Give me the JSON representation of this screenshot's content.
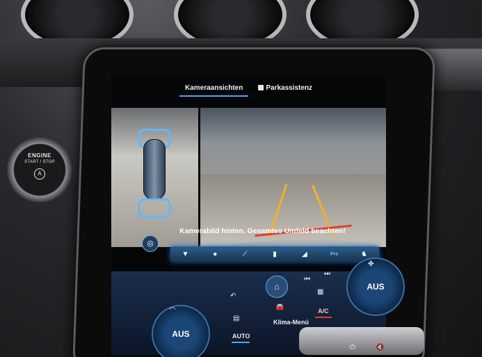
{
  "tabs": [
    {
      "label": "Kameraansichten",
      "active": true
    },
    {
      "label": "Parkassistenz",
      "active": false
    }
  ],
  "camera": {
    "message": "Kamerabild hinten. Gesamtes Umfeld beachten!"
  },
  "view_icons": [
    "view-rear-icon",
    "view-person-icon",
    "view-side-icon",
    "view-car-side-icon",
    "view-car-icon",
    "view-pre-icon",
    "view-trailer-icon"
  ],
  "view_icons_selected_label": "Pre",
  "climate": {
    "left_dial": "AUS",
    "right_dial": "AUS",
    "auto_label": "AUTO",
    "ac_label": "A/C",
    "klima_label": "Klima-Menü"
  },
  "engine": {
    "line1": "ENGINE",
    "line2": "START / STOP"
  },
  "colors": {
    "accent": "#4ea6ff",
    "ac_indicator": "#e23b2b",
    "guide_line": "#f0b030"
  }
}
